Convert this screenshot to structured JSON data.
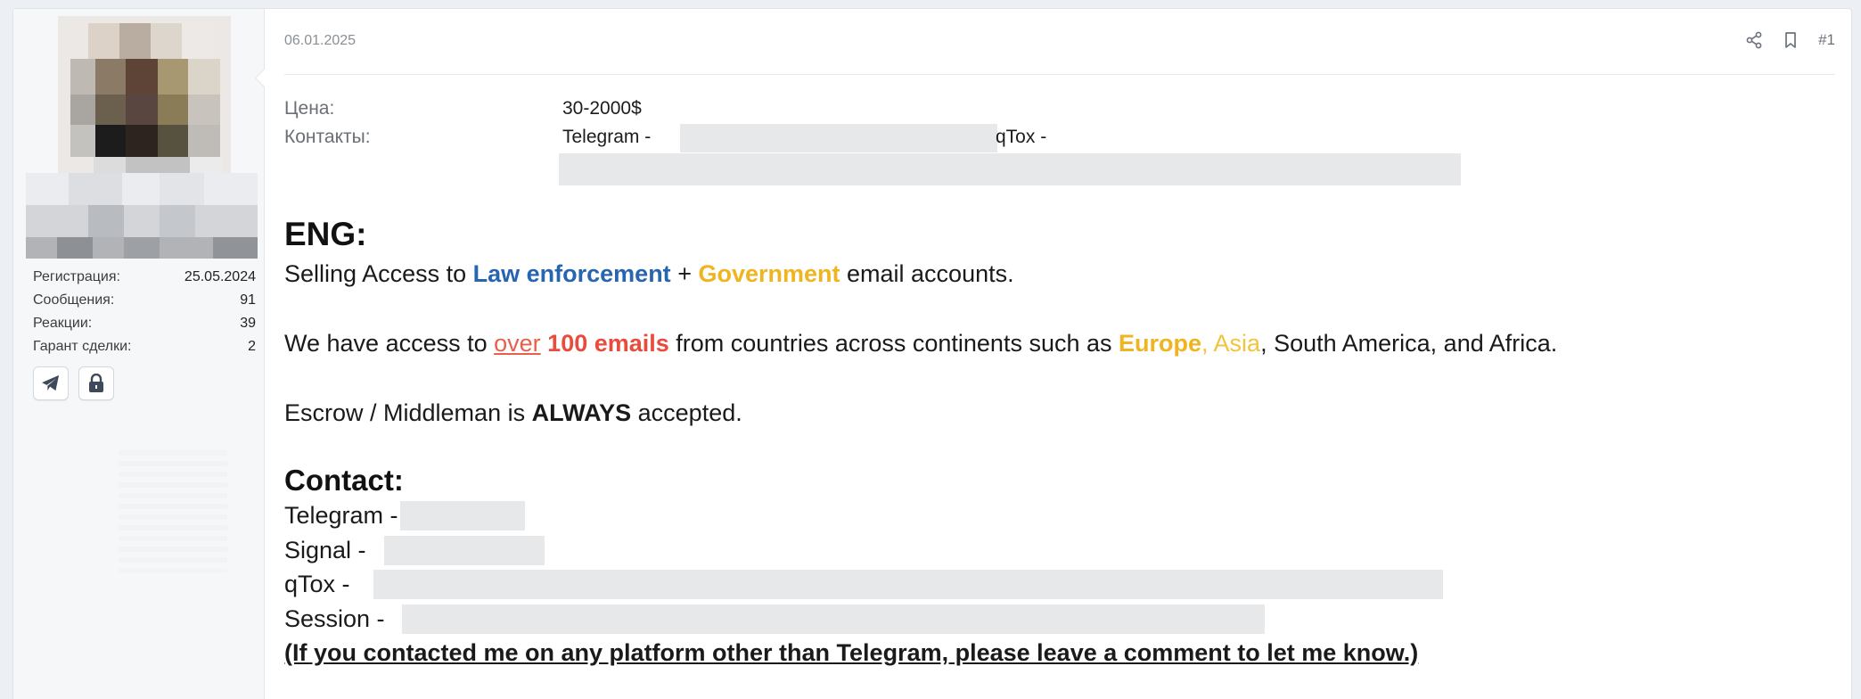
{
  "user": {
    "stats": [
      {
        "label": "Регистрация:",
        "value": "25.05.2024"
      },
      {
        "label": "Сообщения:",
        "value": "91"
      },
      {
        "label": "Реакции:",
        "value": "39"
      },
      {
        "label": "Гарант сделки:",
        "value": "2"
      }
    ],
    "icons": [
      "telegram-icon",
      "lock-icon"
    ]
  },
  "post": {
    "date": "06.01.2025",
    "number": "#1",
    "fields": {
      "price_label": "Цена:",
      "price_value": "30-2000$",
      "contacts_label": "Контакты:",
      "contacts_telegram": "Telegram -",
      "contacts_qtox": "qTox -"
    },
    "body": {
      "heading_eng": "ENG:",
      "line1_a": "Selling Access to ",
      "line1_law": "Law enforcement",
      "line1_plus": " + ",
      "line1_gov": "Government",
      "line1_b": " email accounts.",
      "line2_a": "We have access to ",
      "line2_over": "over",
      "line2_space": " ",
      "line2_count": "100 emails",
      "line2_b": " from countries across continents such as ",
      "line2_europe": "Europe",
      "line2_asia": ", Asia",
      "line2_c": ", South America, and Africa.",
      "line3_a": "Escrow / Middleman is ",
      "line3_always": "ALWAYS",
      "line3_b": " accepted.",
      "contact_heading": "Contact:",
      "contact_telegram": "Telegram -",
      "contact_signal": "Signal -",
      "contact_qtox": "qTox -",
      "contact_session": "Session -",
      "note": "(If you contacted me on any platform other than Telegram, please leave a comment to let me know.)"
    }
  },
  "colors": {
    "blue": "#2865b0",
    "gold": "#efb521",
    "red": "#e84c3d"
  }
}
